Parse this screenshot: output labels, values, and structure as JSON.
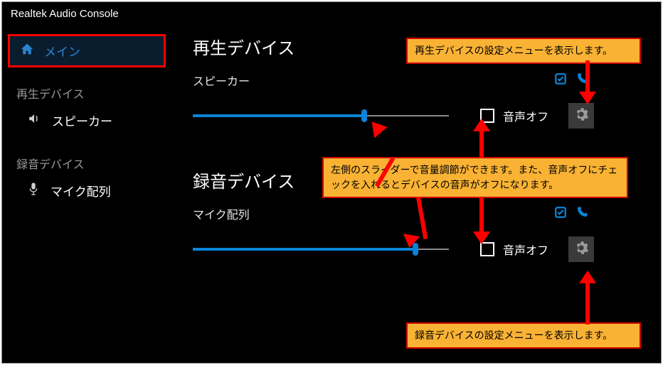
{
  "app": {
    "title": "Realtek Audio Console"
  },
  "sidebar": {
    "main_label": "メイン",
    "playback_group": "再生デバイス",
    "playback_item": "スピーカー",
    "recording_group": "録音デバイス",
    "recording_item": "マイク配列"
  },
  "main": {
    "playback": {
      "title": "再生デバイス",
      "device": "スピーカー",
      "slider_pct": 67,
      "mute_label": "音声オフ",
      "mute_checked": false
    },
    "recording": {
      "title": "録音デバイス",
      "device": "マイク配列",
      "slider_pct": 87,
      "mute_label": "音声オフ",
      "mute_checked": false
    }
  },
  "annotations": {
    "playback_gear": "再生デバイスの設定メニューを表示します。",
    "slider_help": "左側のスライダーで音量調節ができます。また、音声オフにチェックを入れるとデバイスの音声がオフになります。",
    "recording_gear": "録音デバイスの設定メニューを表示します。"
  },
  "colors": {
    "accent": "#0a84d8",
    "callout_bg": "#f9b233",
    "callout_border": "#d00000",
    "highlight_border": "#ff0000"
  }
}
